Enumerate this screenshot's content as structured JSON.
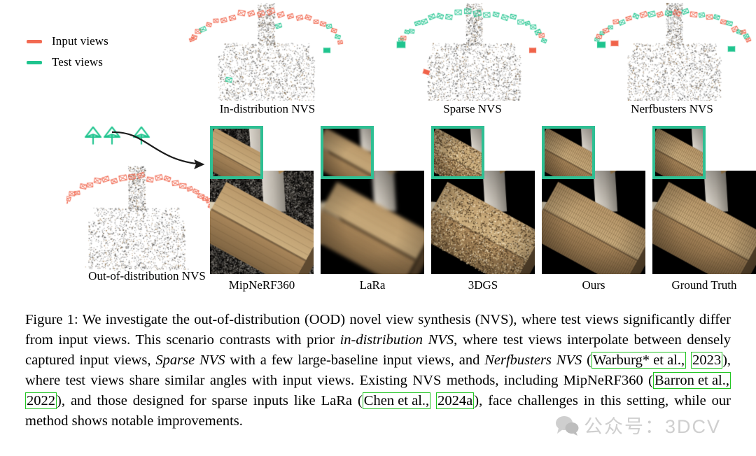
{
  "figure": {
    "legend": {
      "items": [
        {
          "label": "Input views",
          "color": "#f26a52",
          "icon": "dash-line-marker"
        },
        {
          "label": "Test views",
          "color": "#1fc48e",
          "icon": "dash-line-marker"
        }
      ]
    },
    "setting_panels": [
      {
        "id": "in-distribution",
        "label": "In-distribution NVS",
        "input_view_count": 24,
        "test_view_count": 5,
        "arrangement": "dense-ring-inputs-sparse-tests"
      },
      {
        "id": "sparse",
        "label": "Sparse NVS",
        "input_view_count": 4,
        "test_view_count": 26,
        "arrangement": "few-large-baseline-inputs"
      },
      {
        "id": "nerfbusters",
        "label": "Nerfbusters NVS",
        "input_view_count": 18,
        "test_view_count": 18,
        "arrangement": "interleaved-similar-angles"
      },
      {
        "id": "out-of-distribution",
        "label": "Out-of-distribution NVS",
        "input_view_count": 26,
        "test_view_count": 3,
        "arrangement": "inputs-on-ring-tests-overhead"
      }
    ],
    "ood_callout": {
      "icon": "curved-arrow-icon",
      "camera_icon": "camera-frustum-icon",
      "overhead_camera_count": 3
    },
    "methods": [
      {
        "id": "mipnerf360",
        "label": "MipNeRF360",
        "background": "noisy-gray"
      },
      {
        "id": "lara",
        "label": "LaRa",
        "background": "black"
      },
      {
        "id": "3dgs",
        "label": "3DGS",
        "background": "black"
      },
      {
        "id": "ours",
        "label": "Ours",
        "background": "black"
      },
      {
        "id": "ground-truth",
        "label": "Ground Truth",
        "background": "black"
      }
    ],
    "inset_border_color": "#2ebf93"
  },
  "caption": {
    "prefix": "Figure 1:",
    "t1": "  We investigate the out-of-distribution (OOD) novel view synthesis (NVS), where test views significantly differ from input views. This scenario contrasts with prior ",
    "i1": "in-distribution NVS",
    "t2": ", where test views interpolate between densely captured input views, ",
    "i2": "Sparse NVS",
    "t3": " with a few large-baseline input views, and ",
    "i3": "Nerfbusters NVS",
    "t4": " (",
    "c1a": "Warburg* et al.,",
    "c1b": "2023",
    "t5": "), where test views share similar angles with input views. Existing NVS methods, including MipNeRF360 (",
    "c2a": "Barron et al.,",
    "c2b": "2022",
    "t6": "), and those designed for sparse inputs like LaRa (",
    "c3a": "Chen et al.,",
    "c3b": "2024a",
    "t7": "), face challenges in this setting, while our method shows notable improvements."
  },
  "watermark": {
    "text": "公众号：3DCV",
    "icon": "wechat-bubble-icon",
    "color": "#cfcfcf"
  }
}
